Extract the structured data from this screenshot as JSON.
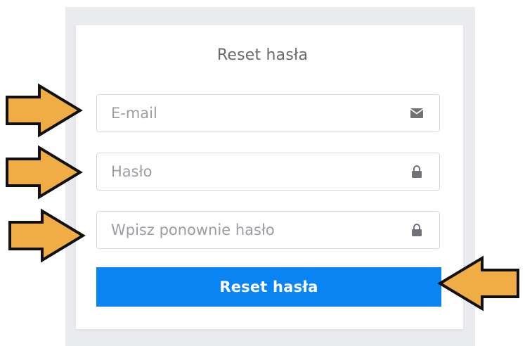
{
  "form": {
    "title": "Reset hasła",
    "email_placeholder": "E-mail",
    "password_placeholder": "Hasło",
    "password_repeat_placeholder": "Wpisz ponownie hasło",
    "submit_label": "Reset hasła"
  },
  "icons": {
    "email": "envelope-icon",
    "password": "lock-icon",
    "password_repeat": "lock-icon"
  },
  "colors": {
    "accent": "#0a84f2",
    "arrow_fill": "#f0ac45",
    "panel_background": "#e9ebee"
  }
}
